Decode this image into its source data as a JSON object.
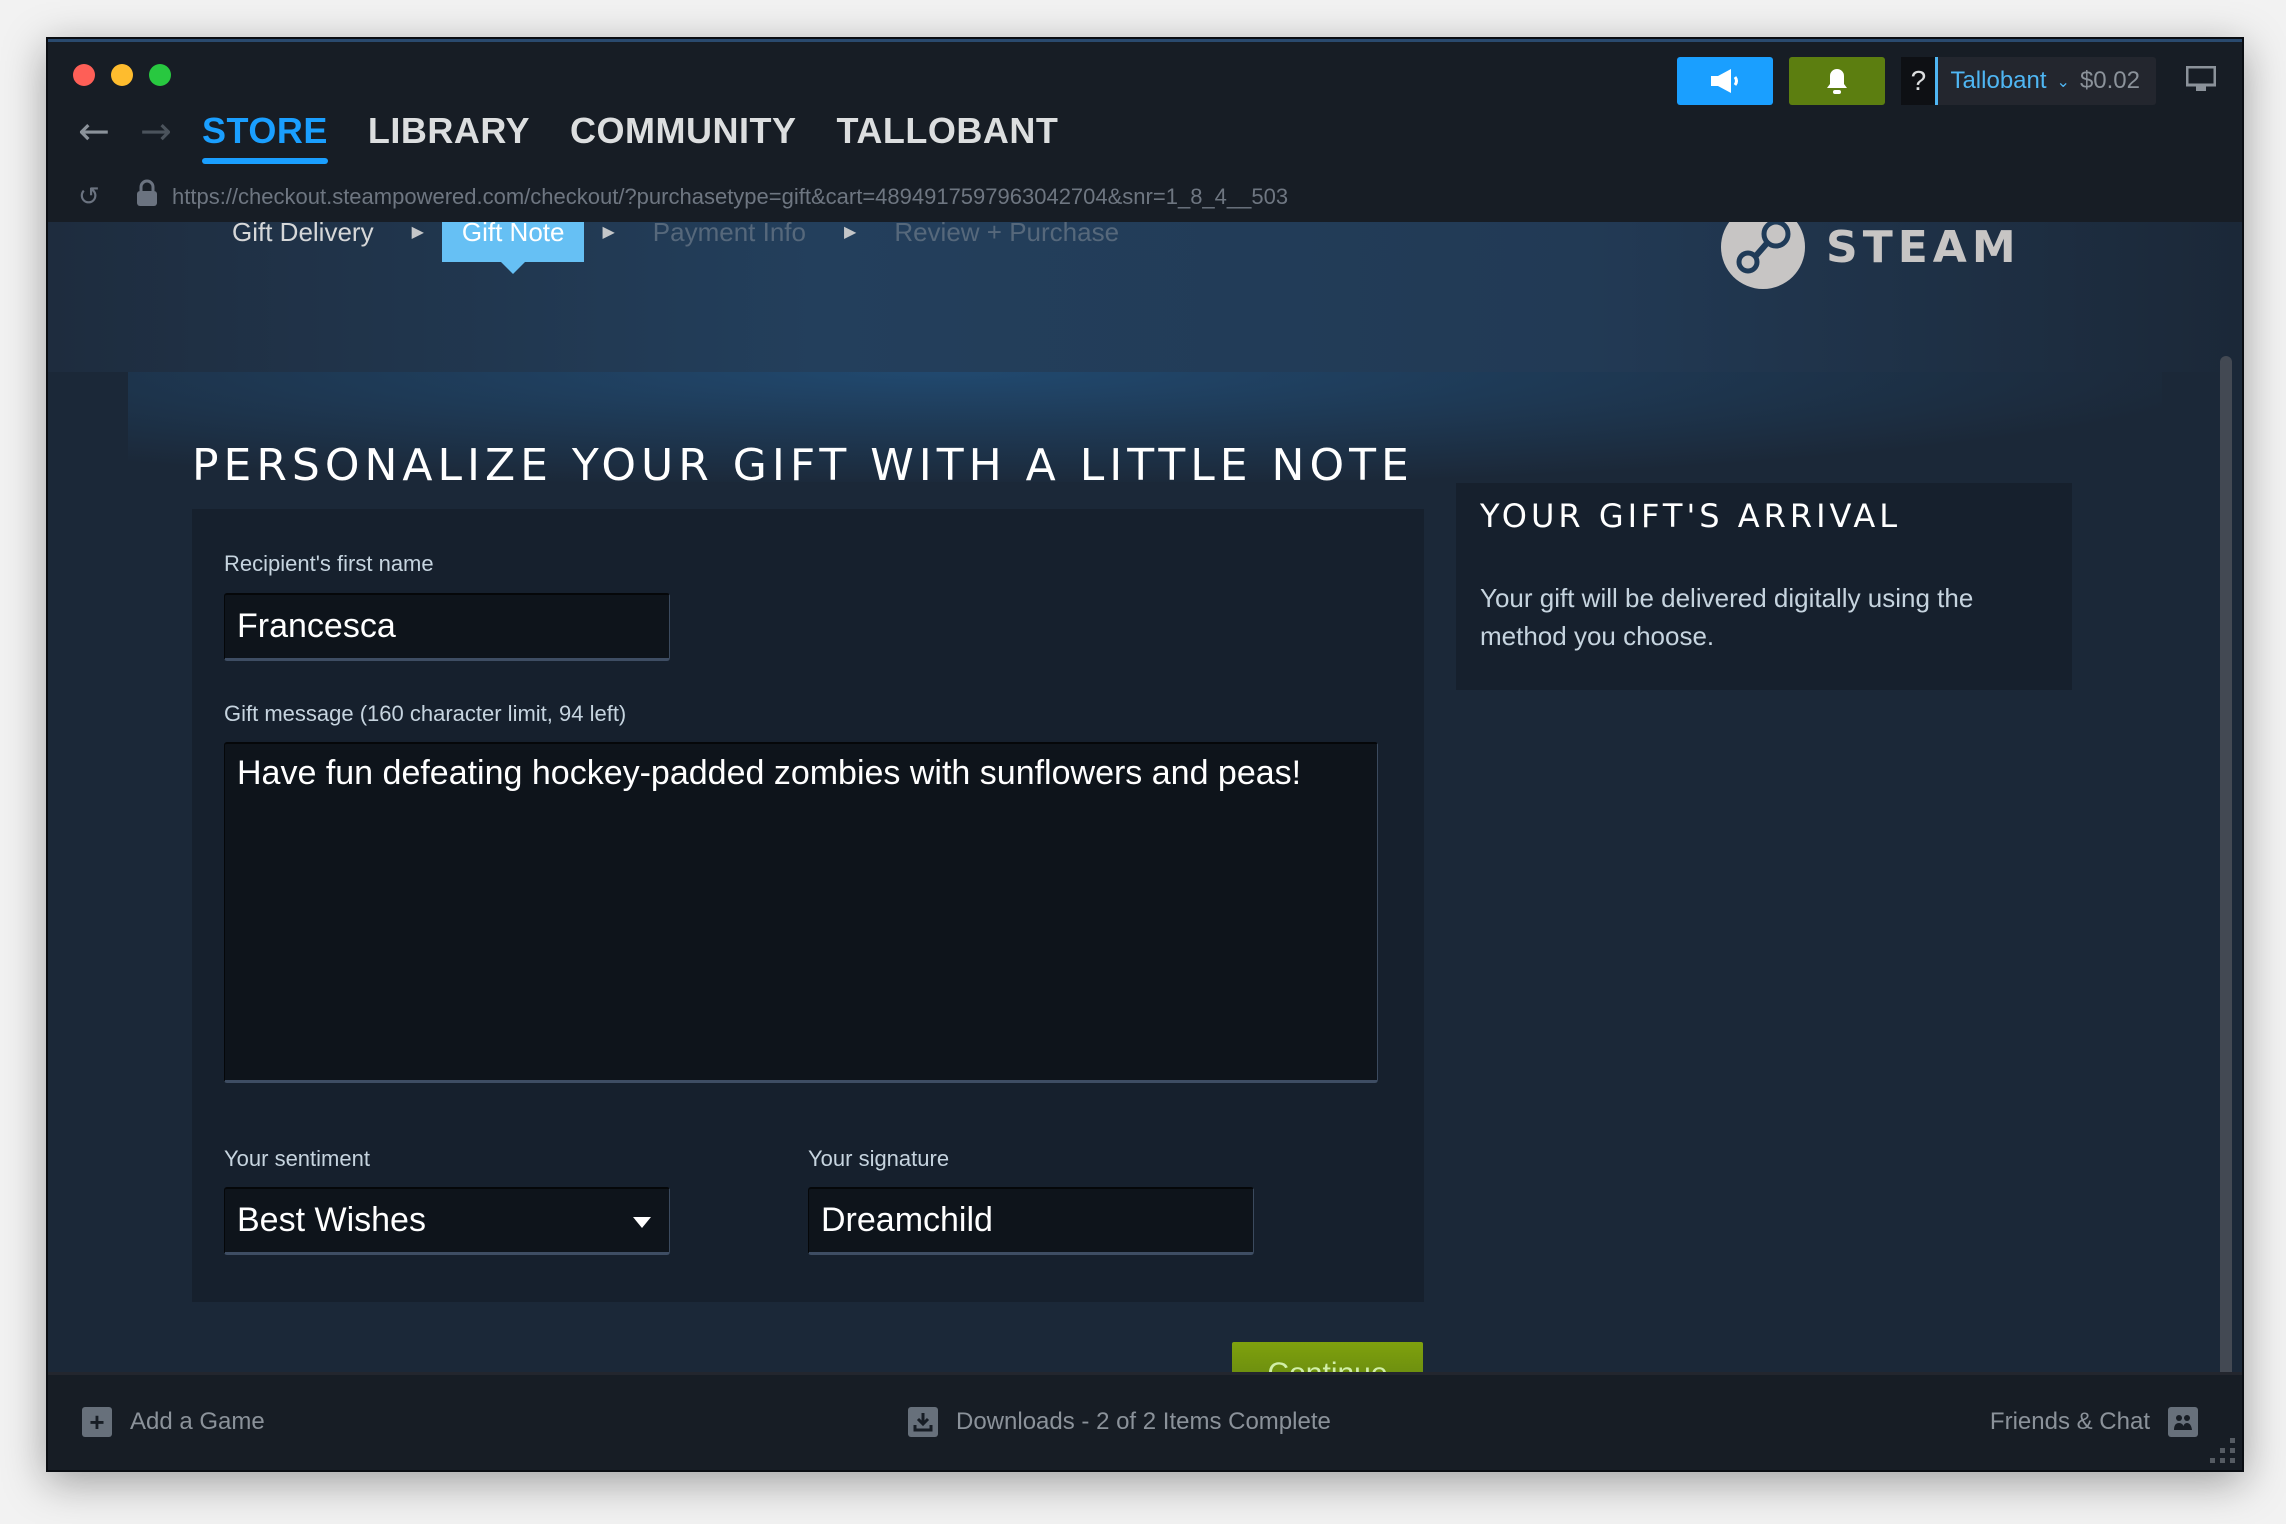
{
  "titlebar": {
    "nav_tabs": [
      {
        "label": "STORE",
        "active": true
      },
      {
        "label": "LIBRARY",
        "active": false
      },
      {
        "label": "COMMUNITY",
        "active": false
      },
      {
        "label": "TALLOBANT",
        "active": false
      }
    ],
    "url": "https://checkout.steampowered.com/checkout/?purchasetype=gift&cart=4894917597963042704&snr=1_8_4__503",
    "account": {
      "help": "?",
      "username": "Tallobant",
      "balance": "$0.02"
    },
    "colors": {
      "accent": "#1a9fff",
      "notification_green": "#5c7e10"
    }
  },
  "steps": {
    "items": [
      {
        "label": "Gift Delivery",
        "state": "done"
      },
      {
        "label": "Gift Note",
        "state": "active"
      },
      {
        "label": "Payment Info",
        "state": "pending"
      },
      {
        "label": "Review + Purchase",
        "state": "pending"
      }
    ],
    "logo_text": "STEAM"
  },
  "page": {
    "title": "PERSONALIZE YOUR GIFT WITH A LITTLE NOTE"
  },
  "form": {
    "recipient_label": "Recipient's first name",
    "recipient_value": "Francesca",
    "message_label": "Gift message (160 character limit, 94 left)",
    "message_value": "Have fun defeating hockey-padded zombies with sunflowers and peas!",
    "sentiment_label": "Your sentiment",
    "sentiment_value": "Best Wishes",
    "signature_label": "Your signature",
    "signature_value": "Dreamchild",
    "continue_label": "Continue"
  },
  "side": {
    "title": "YOUR GIFT'S ARRIVAL",
    "text": "Your gift will be delivered digitally using the method you choose."
  },
  "footer": {
    "add_game": "Add a Game",
    "downloads": "Downloads - 2 of 2 Items Complete",
    "friends": "Friends & Chat"
  }
}
